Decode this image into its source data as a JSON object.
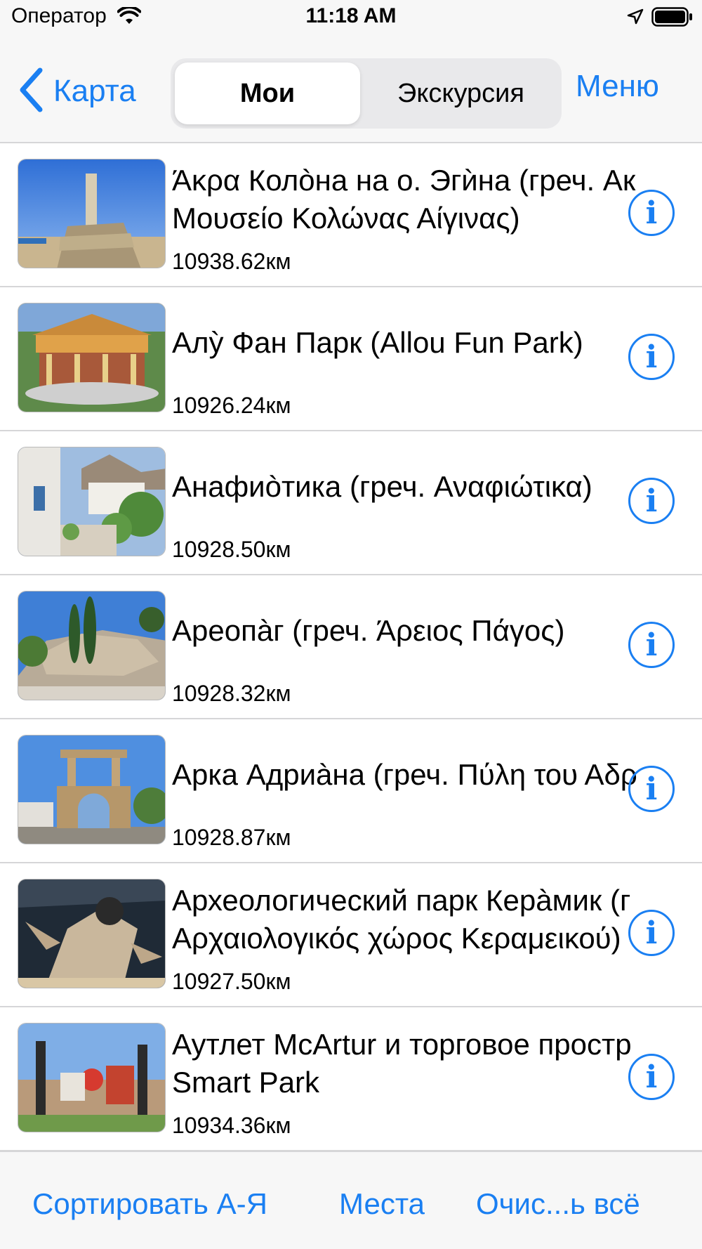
{
  "status_bar": {
    "carrier": "Оператор",
    "time": "11:18 AM"
  },
  "nav": {
    "back_label": "Карта",
    "segments": [
      "Мои",
      "Экскурсия"
    ],
    "selected_segment": "Мои",
    "menu_label": "Меню"
  },
  "places": [
    {
      "title_lines": [
        "Άκρα Колòна на о. Эгѝна (греч. Ак",
        "Μουσείο Κολώνας Αίγινας)"
      ],
      "distance": "10938.62км"
    },
    {
      "title_lines": [
        "Алỳ Фан Парк (Allou Fun Park)"
      ],
      "distance": "10926.24км"
    },
    {
      "title_lines": [
        "Анафиòтика (греч. Αναφιώτικα)"
      ],
      "distance": "10928.50км"
    },
    {
      "title_lines": [
        "Ареопàг (греч. Άρειος Πάγος)"
      ],
      "distance": "10928.32км"
    },
    {
      "title_lines": [
        "Арка Адриàна (греч. Πύλη του Αδρ"
      ],
      "distance": "10928.87км"
    },
    {
      "title_lines": [
        "Археологический парк Керàмик (г",
        "Αρχαιολογικός χώρος Κεραμεικού)"
      ],
      "distance": "10927.50км"
    },
    {
      "title_lines": [
        "Аутлет McArtur и торговое простр",
        "Smart Park"
      ],
      "distance": "10934.36км"
    }
  ],
  "toolbar": {
    "sort_label": "Сортировать А-Я",
    "places_label": "Места",
    "clear_label": "Очис...ь всё"
  },
  "colors": {
    "accent": "#1a7ff2",
    "bar_background": "#f7f7f7",
    "separator": "#d6d6d8"
  },
  "icons": {
    "back": "chevron-left-icon",
    "info": "info-circle-icon",
    "wifi": "wifi-icon",
    "location": "location-arrow-icon",
    "battery": "battery-icon"
  }
}
